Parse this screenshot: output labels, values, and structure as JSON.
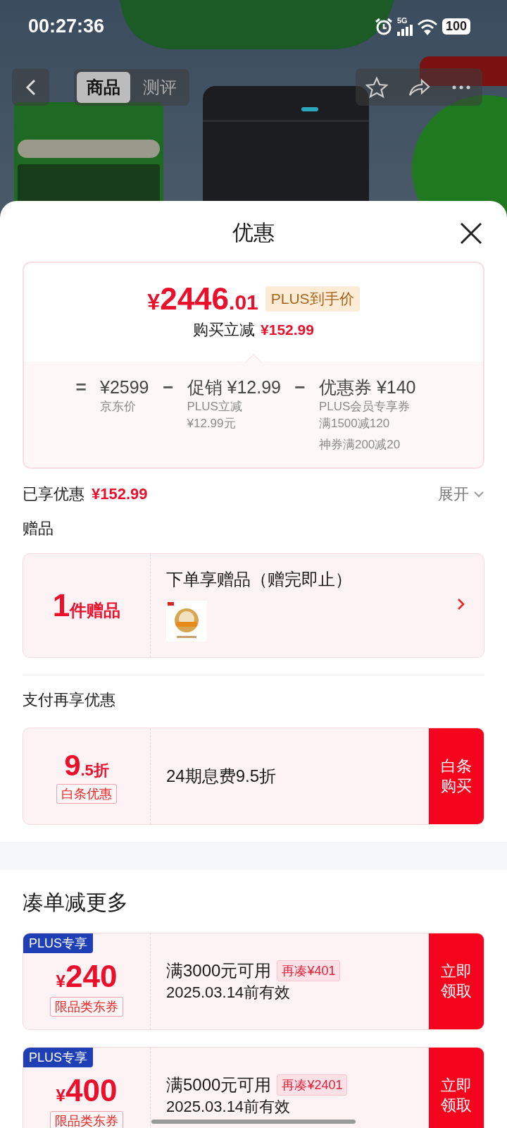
{
  "status_bar": {
    "time": "00:27:36",
    "network": "5G",
    "battery": "100"
  },
  "nav": {
    "tabs": [
      {
        "label": "商品",
        "selected": true
      },
      {
        "label": "测评",
        "selected": false
      }
    ]
  },
  "sheet": {
    "title": "优惠",
    "price_card": {
      "price": {
        "currency": "¥",
        "whole": "2446",
        "fraction": ".01"
      },
      "badge": "PLUS到手价",
      "saving_label": "购买立减",
      "saving": "¥152.99",
      "breakdown": [
        {
          "operator": "=",
          "amount": "¥2599",
          "notes": [
            "京东价"
          ]
        },
        {
          "operator": "−",
          "label": "促销",
          "amount": "¥12.99",
          "notes": [
            "PLUS立减",
            "¥12.99元"
          ]
        },
        {
          "operator": "−",
          "label": "优惠券",
          "amount": "¥140",
          "notes": [
            "PLUS会员专享券",
            "满1500减120",
            "神券满200减20"
          ]
        }
      ]
    },
    "enjoyed": {
      "label": "已享优惠",
      "amount": "¥152.99",
      "toggle": "展开",
      "expanded": false
    },
    "gifts": {
      "heading": "赠品",
      "count": "1",
      "unit": "件赠品",
      "title": "下单享赠品（赠完即止）"
    },
    "payment": {
      "heading": "支付再享优惠",
      "discount": "9",
      "discount_rest": ".5折",
      "tag": "白条优惠",
      "description": "24期息费9.5折",
      "button": "白条购买"
    },
    "bundle": {
      "heading": "凑单减更多",
      "coupons": [
        {
          "badge": "PLUS专享",
          "currency": "¥",
          "amount": "240",
          "scope": "限品类东券",
          "condition": "满3000元可用",
          "gap": "再凑¥401",
          "validity": "2025.03.14前有效",
          "button": "立即领取"
        },
        {
          "badge": "PLUS专享",
          "currency": "¥",
          "amount": "400",
          "scope": "限品类东券",
          "condition": "满5000元可用",
          "gap": "再凑¥2401",
          "validity": "2025.03.14前有效",
          "button": "立即领取"
        }
      ]
    }
  }
}
